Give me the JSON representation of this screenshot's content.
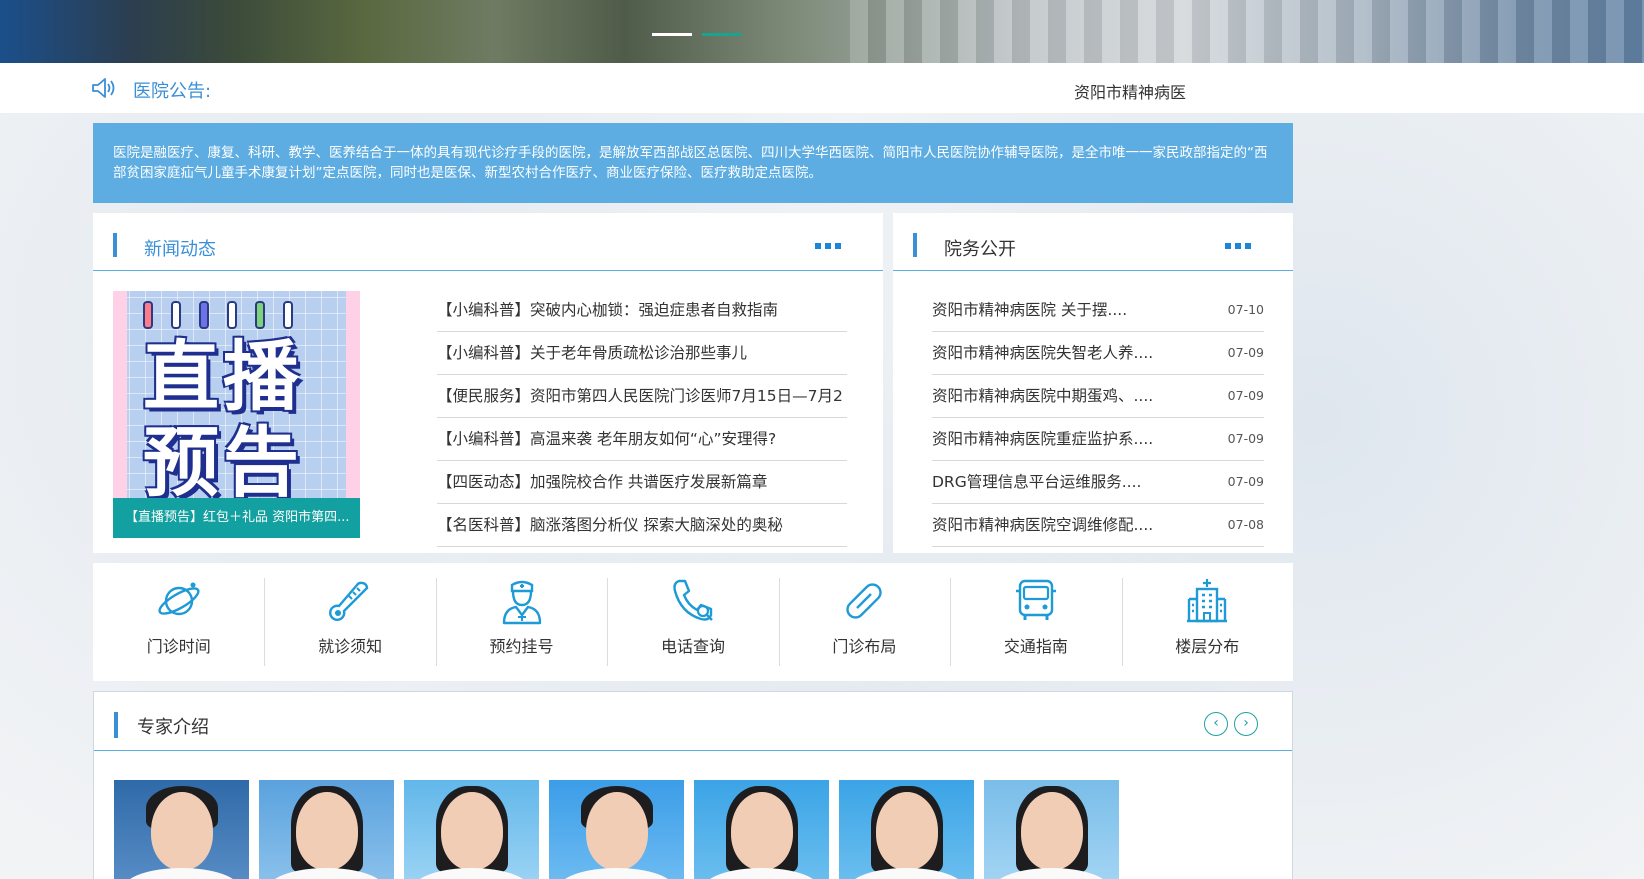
{
  "banner": {
    "slides": 2,
    "active_slide": 2
  },
  "notice": {
    "label": "医院公告:",
    "scroll_text": "资阳市精神病医"
  },
  "intro": {
    "text": "医院是融医疗、康复、科研、教学、医养结合于一体的具有现代诊疗手段的医院，是解放军西部战区总医院、四川大学华西医院、简阳市人民医院协作辅导医院，是全市唯一一家民政部指定的“西部贫困家庭疝气儿童手术康复计划”定点医院，同时也是医保、新型农村合作医疗、商业医疗保险、医疗救助定点医院。"
  },
  "news": {
    "title": "新闻动态",
    "image_caption": "【直播预告】红包＋礼品 资阳市第四...",
    "image_text_line1": "直播",
    "image_text_line2": "预告",
    "items": [
      "【小编科普】突破内心枷锁：强迫症患者自救指南",
      "【小编科普】关于老年骨质疏松诊治那些事儿",
      "【便民服务】资阳市第四人民医院门诊医师7月15日—7月2",
      "【小编科普】高温来袭 老年朋友如何“心”安理得?",
      "【四医动态】加强院校合作 共谱医疗发展新篇章",
      "【名医科普】脑涨落图分析仪 探索大脑深处的奥秘"
    ]
  },
  "affairs": {
    "title": "院务公开",
    "items": [
      {
        "title": "资阳市精神病医院 关于摆....",
        "date": "07-10"
      },
      {
        "title": "资阳市精神病医院失智老人养....",
        "date": "07-09"
      },
      {
        "title": "资阳市精神病医院中期蛋鸡、....",
        "date": "07-09"
      },
      {
        "title": "资阳市精神病医院重症监护系....",
        "date": "07-09"
      },
      {
        "title": "DRG管理信息平台运维服务....",
        "date": "07-09"
      },
      {
        "title": "资阳市精神病医院空调维修配....",
        "date": "07-08"
      }
    ]
  },
  "services": [
    {
      "label": "门诊时间",
      "icon": "planet-icon"
    },
    {
      "label": "就诊须知",
      "icon": "thermometer-icon"
    },
    {
      "label": "预约挂号",
      "icon": "nurse-icon"
    },
    {
      "label": "电话查询",
      "icon": "phone-search-icon"
    },
    {
      "label": "门诊布局",
      "icon": "pill-icon"
    },
    {
      "label": "交通指南",
      "icon": "bus-icon"
    },
    {
      "label": "楼层分布",
      "icon": "hospital-building-icon"
    }
  ],
  "experts": {
    "title": "专家介绍",
    "prev": "‹",
    "next": "›"
  },
  "colors": {
    "accent": "#3a8fd6",
    "intro_bg": "#5dade2",
    "teal": "#13a0a0"
  }
}
